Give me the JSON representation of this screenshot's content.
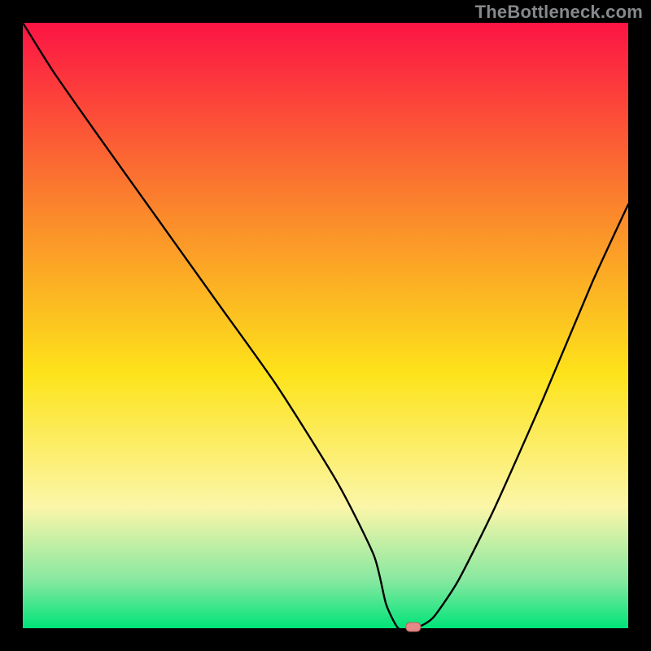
{
  "watermark": "TheBottleneck.com",
  "chart_data": {
    "type": "line",
    "title": "",
    "xlabel": "",
    "ylabel": "",
    "xlim": [
      0,
      100
    ],
    "ylim": [
      0,
      100
    ],
    "series": [
      {
        "name": "bottleneck-curve",
        "x": [
          0,
          5,
          12,
          22,
          32,
          42,
          52,
          58,
          60,
          62,
          64,
          66,
          68,
          72,
          78,
          86,
          94,
          100
        ],
        "y": [
          100,
          92,
          82,
          68,
          54,
          40,
          24,
          12,
          4,
          0,
          0,
          0.5,
          2,
          8,
          20,
          38,
          57,
          70
        ]
      }
    ],
    "marker": {
      "x": 64.5,
      "y": 0
    },
    "colors": {
      "curve": "#000000",
      "marker_fill": "#e58a87",
      "marker_stroke": "#b6625f",
      "gradient_top": "#fc1444",
      "gradient_mid_top": "#fb8a2b",
      "gradient_mid": "#fde31a",
      "gradient_low": "#fbf6a9",
      "gradient_green_soft": "#88e8a0",
      "gradient_green": "#00e47a",
      "frame": "#000000"
    }
  }
}
